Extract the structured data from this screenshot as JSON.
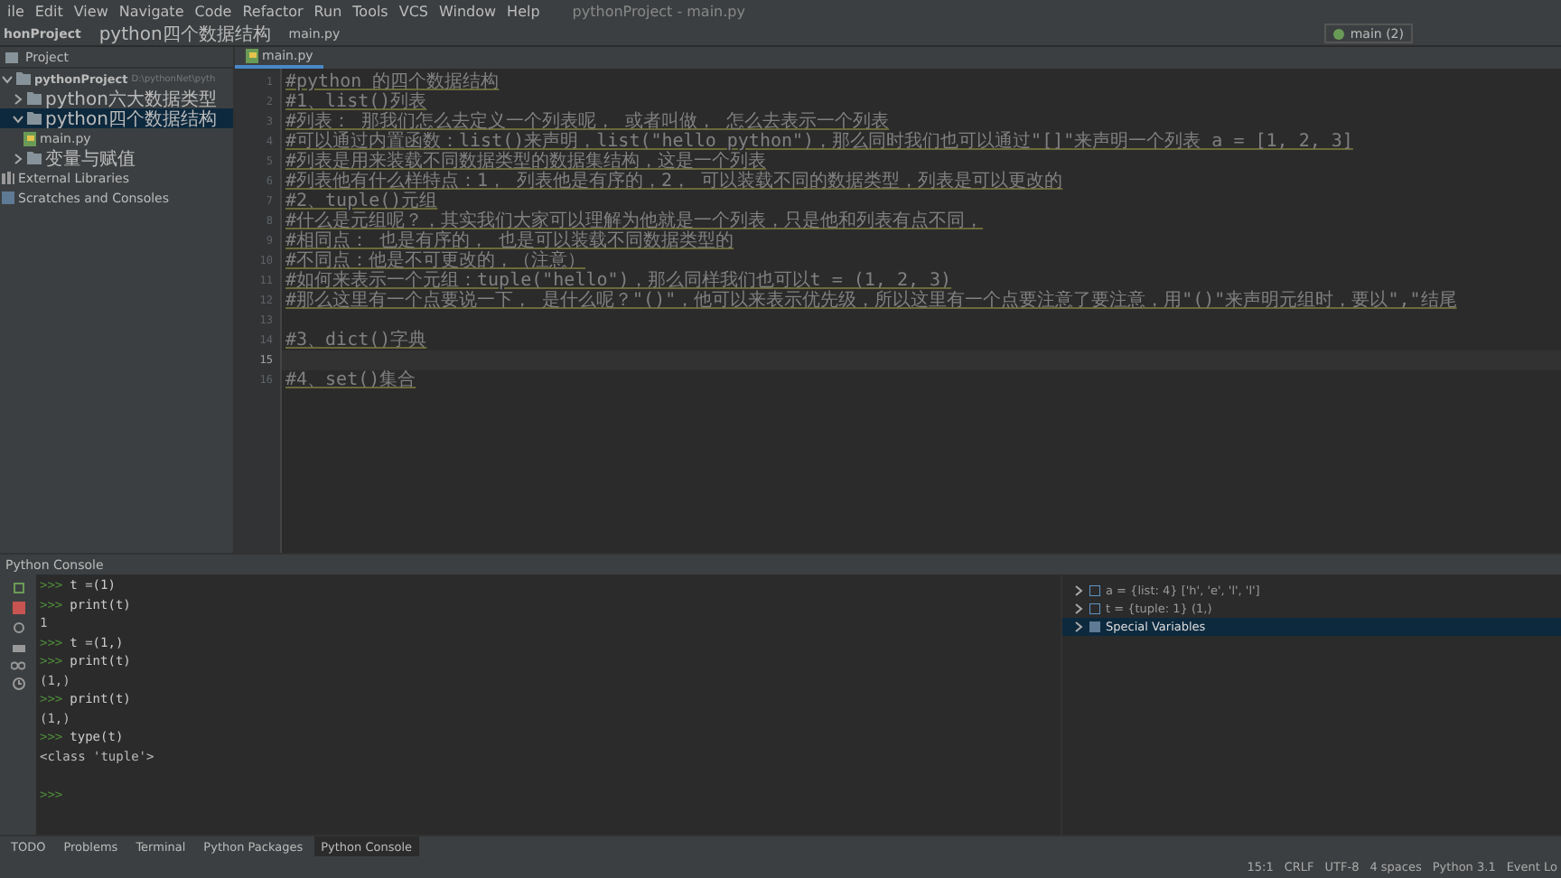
{
  "menu": [
    "ile",
    "Edit",
    "View",
    "Navigate",
    "Code",
    "Refactor",
    "Run",
    "Tools",
    "VCS",
    "Window",
    "Help"
  ],
  "window": {
    "title": "pythonProject - main.py"
  },
  "breadcrumbs": [
    "honProject",
    "python四个数据结构",
    "main.py"
  ],
  "run_config": "main (2)",
  "project": {
    "header": "Project",
    "tree": [
      {
        "label": "pythonProject",
        "note": "D:\\pythonNet\\pyth",
        "kind": "folder",
        "expanded": true,
        "selected": false,
        "children": [
          {
            "label": "python六大数据类型",
            "kind": "folder",
            "expanded": false,
            "selected": false
          },
          {
            "label": "python四个数据结构",
            "kind": "folder",
            "expanded": true,
            "selected": true,
            "children": [
              {
                "label": "main.py",
                "kind": "file",
                "selected": false
              }
            ]
          },
          {
            "label": "变量与赋值",
            "kind": "folder",
            "expanded": false,
            "selected": false
          }
        ]
      },
      {
        "label": "External Libraries",
        "kind": "library",
        "selected": false
      },
      {
        "label": "Scratches and Consoles",
        "kind": "scratch",
        "selected": false
      }
    ]
  },
  "editor": {
    "tab": "main.py",
    "lines": [
      {
        "number": "1",
        "text": "#python 的四个数据结构",
        "current": false
      },
      {
        "number": "2",
        "text": "#1、list()列表",
        "current": false
      },
      {
        "number": "3",
        "text": "#列表：  那我们怎么去定义一个列表呢，  或者叫做，  怎么去表示一个列表",
        "current": false
      },
      {
        "number": "4",
        "text": "#可以通过内置函数：list()来声明，list(\"hello python\")，那么同时我们也可以通过\"[]\"来声明一个列表 a = [1, 2, 3]",
        "current": false
      },
      {
        "number": "5",
        "text": "#列表是用来装载不同数据类型的数据集结构，这是一个列表",
        "current": false
      },
      {
        "number": "6",
        "text": "#列表他有什么样特点：1，  列表他是有序的，2，  可以装载不同的数据类型，列表是可以更改的",
        "current": false
      },
      {
        "number": "7",
        "text": "#2、tuple()元组",
        "current": false
      },
      {
        "number": "8",
        "text": "#什么是元组呢？，其实我们大家可以理解为他就是一个列表，只是他和列表有点不同，",
        "current": false
      },
      {
        "number": "9",
        "text": "#相同点：  也是有序的，  也是可以装载不同数据类型的",
        "current": false
      },
      {
        "number": "10",
        "text": "#不同点：他是不可更改的，（注意）",
        "current": false
      },
      {
        "number": "11",
        "text": "#如何来表示一个元组：tuple(\"hello\")，那么同样我们也可以t = (1, 2, 3)",
        "current": false
      },
      {
        "number": "12",
        "text": "#那么这里有一个点要说一下，  是什么呢？\"()\"，他可以来表示优先级，所以这里有一个点要注意了要注意，用\"()\"来声明元组时，要以\",\"结尾",
        "current": false
      },
      {
        "number": "13",
        "current": false
      },
      {
        "number": "14",
        "text": "#3、dict()字典",
        "current": false
      },
      {
        "number": "15",
        "current": true
      },
      {
        "number": "16",
        "text": "#4、set()集合",
        "current": false
      }
    ]
  },
  "console": {
    "title": "Python Console",
    "lines": [
      {
        "kind": "input",
        "prompt": ">>>",
        "text": "t =(1)"
      },
      {
        "kind": "input",
        "prompt": ">>>",
        "text": "print(t)"
      },
      {
        "kind": "output",
        "text": "1"
      },
      {
        "kind": "input",
        "prompt": ">>>",
        "text": "t =(1,)"
      },
      {
        "kind": "input",
        "prompt": ">>>",
        "text": "print(t)"
      },
      {
        "kind": "output",
        "text": "(1,)"
      },
      {
        "kind": "input",
        "prompt": ">>>",
        "text": "print(t)"
      },
      {
        "kind": "output",
        "text": "(1,)"
      },
      {
        "kind": "input",
        "prompt": ">>>",
        "text": "type(t)"
      },
      {
        "kind": "output",
        "text": "<class 'tuple'>"
      },
      {
        "kind": "blank"
      },
      {
        "kind": "input",
        "prompt": ">>>"
      }
    ]
  },
  "variables": [
    {
      "text": "a = {list: 4} ['h', 'e', 'l', 'l']",
      "kind": "var",
      "selected": false
    },
    {
      "text": "t = {tuple: 1} (1,)",
      "kind": "var",
      "selected": false
    },
    {
      "text": "Special Variables",
      "kind": "special",
      "selected": true
    }
  ],
  "tool_tabs": [
    {
      "label": "TODO",
      "selected": false
    },
    {
      "label": "Problems",
      "selected": false
    },
    {
      "label": "Terminal",
      "selected": false
    },
    {
      "label": "Python Packages",
      "selected": false
    },
    {
      "label": "Python Console",
      "selected": true
    }
  ],
  "status": {
    "items": [
      "15:1",
      "CRLF",
      "UTF-8",
      "4 spaces",
      "Python 3.1"
    ],
    "event_log": "Event Lo"
  }
}
